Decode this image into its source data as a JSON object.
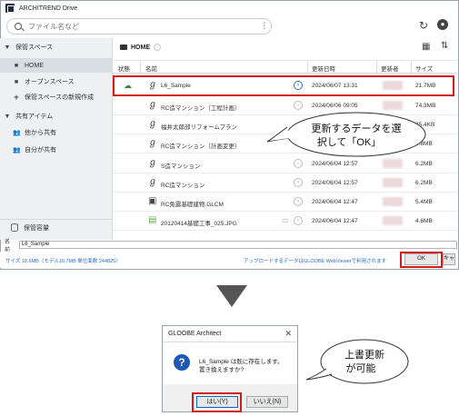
{
  "window": {
    "title": "ARCHITREND Drive"
  },
  "search": {
    "placeholder": "ファイル名など"
  },
  "sidebar": {
    "items": [
      {
        "label": "保管スペース",
        "icon": "triangle-down-icon"
      },
      {
        "label": "HOME",
        "icon": "folder-icon"
      },
      {
        "label": "オープンスペース",
        "icon": "folder-icon"
      },
      {
        "label": "保管スペースの新規作成",
        "icon": "plus-icon"
      },
      {
        "label": "共有アイテム",
        "icon": "triangle-down-icon"
      },
      {
        "label": "他から共有",
        "icon": "people-icon"
      },
      {
        "label": "自分が共有",
        "icon": "people-icon"
      }
    ],
    "storage_label": "保管容量"
  },
  "breadcrumb": {
    "current": "HOME"
  },
  "table": {
    "headers": [
      "状態",
      "名前",
      "更新日時",
      "更新者",
      "サイズ"
    ],
    "rows": [
      {
        "name": "L6_Sample",
        "date": "2024/06/07 13:31",
        "size": "21.7MB",
        "icon": "gloobe-icon",
        "status": "sync-icon"
      },
      {
        "name": "RC造マンション（工程計画）",
        "date": "2024/06/06 09:05",
        "size": "74.3MB",
        "icon": "gloobe-icon"
      },
      {
        "name": "福井太郎邸リフォームプラン",
        "date": "",
        "size": "25.4KB",
        "icon": "gloobe-icon"
      },
      {
        "name": "RC造マンション（計画変更）",
        "date": "",
        "size": "9.8MB",
        "icon": "gloobe-icon"
      },
      {
        "name": "S造マンション",
        "date": "2024/06/04 12:57",
        "size": "6.2MB",
        "icon": "gloobe-icon"
      },
      {
        "name": "RC造マンション",
        "date": "2024/06/04 12:57",
        "size": "6.2MB",
        "icon": "gloobe-icon"
      },
      {
        "name": "RC免震基礎建物.GLCM",
        "date": "2024/06/04 12:47",
        "size": "5.4MB",
        "icon": "model-file-icon"
      },
      {
        "name": "20120414基礎工事_025.JPG",
        "date": "2024/06/04 12:47",
        "size": "4.6MB",
        "icon": "image-file-icon"
      }
    ]
  },
  "namebar": {
    "label": "名前",
    "value": "L6_Sample"
  },
  "statusbar": {
    "info": "サイズ 18.6MB（モデル10.7MB 単位面数 244825）",
    "upload_link": "アップロードするデータはGLOOBE WebViewerで利用されます",
    "ok_label": "OK",
    "cancel_label": "キャンセル"
  },
  "callout1": {
    "line1": "更新するデータを選",
    "line2": "択して「OK」"
  },
  "dialog": {
    "title": "GLOOBE Architect",
    "message_line1": "L6_Sample は既に存在します。",
    "message_line2": "置き換えますか?",
    "yes_label": "はい(Y)",
    "no_label": "いいえ(N)"
  },
  "callout2": {
    "line1": "上書更新",
    "line2": "が可能"
  },
  "colors": {
    "highlight_red": "#d11c1c",
    "link_blue": "#2a6bc4",
    "question_blue": "#1f57b5"
  }
}
